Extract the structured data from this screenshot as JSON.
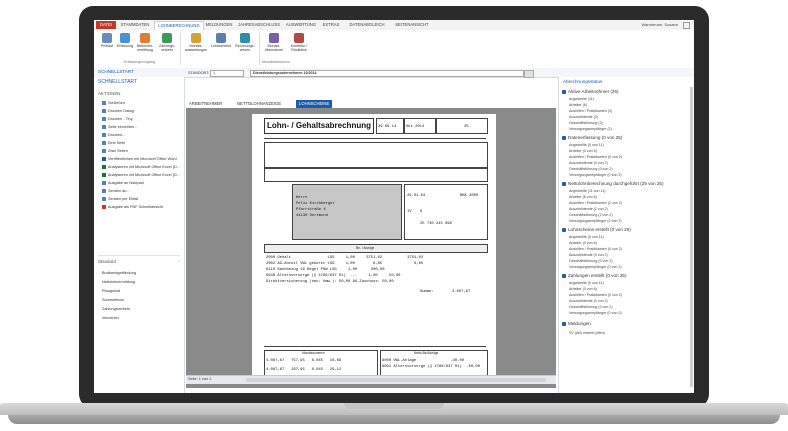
{
  "ribbon": {
    "tabs": [
      "DATEI",
      "STAMMDATEN",
      "LOHNBERECHNUNG",
      "MELDUNGEN",
      "JAHRESABSCHLUSS",
      "AUSWERTUNG",
      "EXTRAS",
      "DATENABGLEICH",
      "SEITENANSICHT"
    ],
    "user": "Warmbrunn, Susann",
    "buttons": [
      "Prüflauf",
      "Erfassung",
      "Nettolohn-ermittlung",
      "Zahlungs-verkehr",
      "Monats-auswertungen",
      "Lohnscheine",
      "Rechnungs-wesen",
      "Monats-übernahme",
      "Korrektur / Rückblick"
    ],
    "groups": [
      "Erfassungsvorgang",
      "Monatsabschluss"
    ]
  },
  "nav": {
    "label": "SCHNELLSTART"
  },
  "left": {
    "actions_title": "AKTIONEN",
    "actions": [
      "Schließen",
      "Drucken Dialog",
      "Drucken - Tiny",
      "Seite einrichten...",
      "Drucken...",
      "Eine Seite",
      "Zwei Seiten",
      "Veröffentlichen mit Microsoft Office Word",
      "Analysieren mit Microsoft Office Excel (D...",
      "Analysieren mit Microsoft Office Excel (D...",
      "Ausgabe an Notepad",
      "Senden an...",
      "Senden per EMail",
      "Ausgabe als PDF Schnellansicht"
    ],
    "standard_title": "Standard",
    "standard": [
      "Bruttoentgeltfindung",
      "Nettolohnermittlung",
      "Pfaugumal",
      "Summeltruck",
      "Zahlungsverkehr",
      "Infocenter"
    ]
  },
  "combo": {
    "label": "STANDORT:",
    "value": "1",
    "center": "Dienstleistungsunternehmen 10/2014"
  },
  "doc_tabs": [
    "ARBEITNEHMER",
    "NETTOLOHNANZEIGE",
    "LOHNSCHEINE"
  ],
  "doc": {
    "title": "Lohn- / Gehaltsabrechnung",
    "date": "29.09.14",
    "period": "Okt 2014",
    "personal_no": "25",
    "address": [
      "Herrn",
      "Felix Kirchberger",
      "Pfarrstraße 4",
      "44130 Dortmund"
    ],
    "entry_date": "29.01.04",
    "tax_class": "IV",
    "tax_extra": "0",
    "rv": "RKK 2000",
    "insurer": "25 730 245 690",
    "section_title": "Be- / Abzüge",
    "lines": [
      "2000 Gehalt                LSG     1,00     3751,02           3751,02",
      "2002 AG-Anteil VWL gekürzt LSG     1,00        6,65              6,65",
      "9110 Sachbezug 16 Kegel PKW LSG     1,00      300,00",
      "9048 Altersvorsorge (§ 4766/637 01)  ---     1,00     50,00",
      "Direktversicherung (neu: Umw.): 50,00 AG-Zuschuss: 50,00"
    ],
    "summe_label": "Summe:",
    "summe_value": "3.807,67",
    "bottom_left_title": "Monatssummen",
    "bottom_left_rows": [
      "4.087,67   757,95   8.045   16,69",
      "4.087,67   287,95   8.045   29,12"
    ],
    "bottom_right_title": "Netto-Be/Abzüge",
    "bottom_right_rows": [
      "8000 VWL-Anlage               -40,00",
      "8091 Altersvorsorge (§ 4766/637 01)  -50,00"
    ],
    "page_label": "Seite: 1 von 1"
  },
  "right": {
    "title": "Abrechnungsstatus",
    "sections": [
      {
        "title": "Aktive Arbeitnehmer (25)",
        "items": [
          "Angestellte (11)",
          "Arbeiter (6)",
          "Aushilfen / Praktikanten (2)",
          "Auszubildende (2)",
          "Geschäftsführung (2)",
          "Versorgungsempfänger (2)"
        ]
      },
      {
        "title": "Datenerfassung (0 von 25)",
        "items": [
          "Angestellte (0 von 11)",
          "Arbeiter (0 von 6)",
          "Aushilfen / Praktikanten (0 von 2)",
          "Auszubildende (0 von 2)",
          "Geschäftsführung (0 von 2)",
          "Versorgungsempfänger (0 von 2)"
        ]
      },
      {
        "title": "Nettolohnberechnung durchgeführt (25 von 25)",
        "items": [
          "Angestellte (11 von 11)",
          "Arbeiter (6 von 6)",
          "Aushilfen / Praktikanten (2 von 2)",
          "Auszubildende (2 von 2)",
          "Geschäftsführung (2 von 2)",
          "Versorgungsempfänger (2 von 2)"
        ]
      },
      {
        "title": "Lohnscheine erstellt (0 von 25)",
        "items": [
          "Angestellte (0 von 11)",
          "Arbeiter (0 von 6)",
          "Aushilfen / Praktikanten (0 von 2)",
          "Auszubildende (0 von 2)",
          "Geschäftsführung (0 von 2)",
          "Versorgungsempfänger (0 von 2)"
        ]
      },
      {
        "title": "Zahlungen erstellt (0 von 25)",
        "items": [
          "Angestellte (0 von 11)",
          "Arbeiter (0 von 6)",
          "Aushilfen / Praktikanten (0 von 2)",
          "Auszubildende (0 von 2)",
          "Geschäftsführung (0 von 2)",
          "Versorgungsempfänger (0 von 2)"
        ]
      },
      {
        "title": "Meldungen",
        "items": [
          "SV (AB) erstellt (offen)"
        ]
      }
    ]
  }
}
